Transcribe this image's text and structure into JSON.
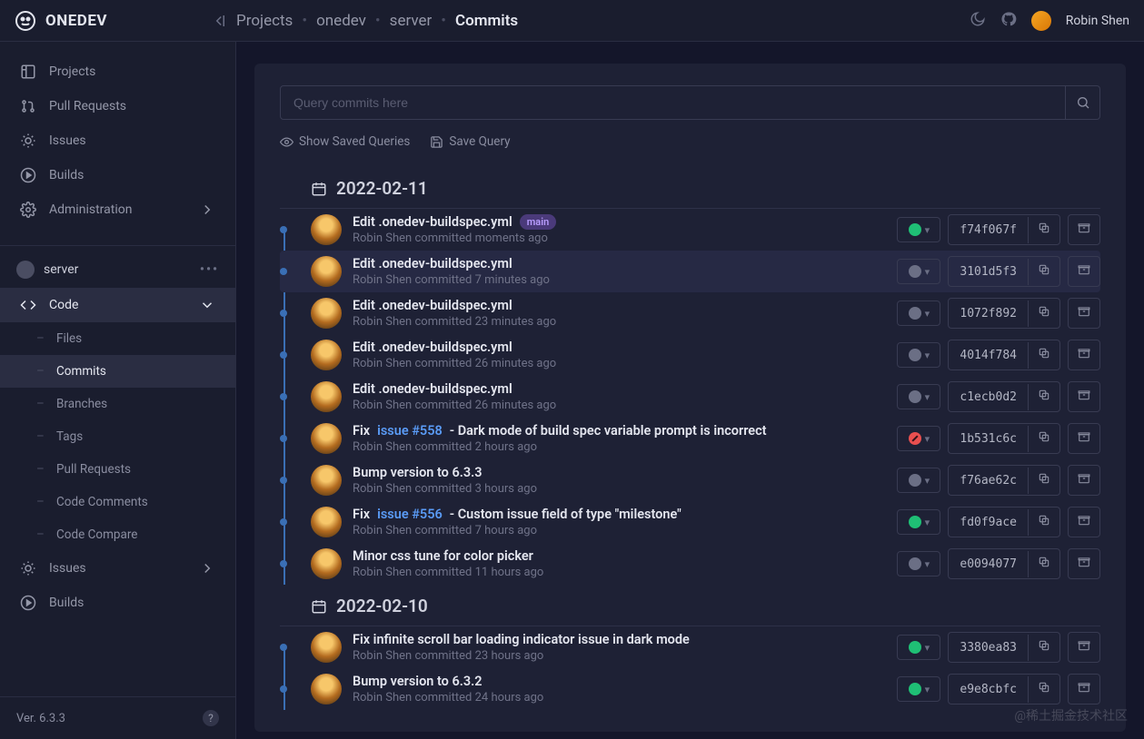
{
  "brand": {
    "name": "ONEDEV"
  },
  "breadcrumb": {
    "items": [
      "Projects",
      "onedev",
      "server",
      "Commits"
    ]
  },
  "user": {
    "name": "Robin Shen"
  },
  "sidebar": {
    "primary": [
      {
        "label": "Projects",
        "icon": "project-icon"
      },
      {
        "label": "Pull Requests",
        "icon": "pull-request-icon"
      },
      {
        "label": "Issues",
        "icon": "bug-icon"
      },
      {
        "label": "Builds",
        "icon": "play-icon"
      },
      {
        "label": "Administration",
        "icon": "gear-icon",
        "expandable": true
      }
    ],
    "project": {
      "name": "server"
    },
    "code": {
      "label": "Code",
      "children": [
        {
          "label": "Files"
        },
        {
          "label": "Commits",
          "active": true
        },
        {
          "label": "Branches"
        },
        {
          "label": "Tags"
        },
        {
          "label": "Pull Requests"
        },
        {
          "label": "Code Comments"
        },
        {
          "label": "Code Compare"
        }
      ]
    },
    "secondary": [
      {
        "label": "Issues",
        "icon": "bug-icon",
        "expandable": true
      },
      {
        "label": "Builds",
        "icon": "play-icon"
      }
    ],
    "version": "Ver. 6.3.3"
  },
  "search": {
    "placeholder": "Query commits here"
  },
  "query_actions": {
    "show": "Show Saved Queries",
    "save": "Save Query"
  },
  "groups": [
    {
      "date": "2022-02-11",
      "commits": [
        {
          "title": "Edit .onedev-buildspec.yml",
          "badge": "main",
          "author": "Robin Shen",
          "time": "moments ago",
          "status": "success",
          "hash": "f74f067f"
        },
        {
          "title": "Edit .onedev-buildspec.yml",
          "author": "Robin Shen",
          "time": "7 minutes ago",
          "status": "running",
          "hash": "3101d5f3",
          "hover": true
        },
        {
          "title": "Edit .onedev-buildspec.yml",
          "author": "Robin Shen",
          "time": "23 minutes ago",
          "status": "running",
          "hash": "1072f892"
        },
        {
          "title": "Edit .onedev-buildspec.yml",
          "author": "Robin Shen",
          "time": "26 minutes ago",
          "status": "running",
          "hash": "4014f784"
        },
        {
          "title": "Edit .onedev-buildspec.yml",
          "author": "Robin Shen",
          "time": "26 minutes ago",
          "status": "running",
          "hash": "c1ecb0d2"
        },
        {
          "title_prefix": "Fix ",
          "issue": "issue #558",
          "title_suffix": " - Dark mode of build spec variable prompt is incorrect",
          "author": "Robin Shen",
          "time": "2 hours ago",
          "status": "failed",
          "hash": "1b531c6c"
        },
        {
          "title": "Bump version to 6.3.3",
          "author": "Robin Shen",
          "time": "3 hours ago",
          "status": "running",
          "hash": "f76ae62c"
        },
        {
          "title_prefix": "Fix ",
          "issue": "issue #556",
          "title_suffix": " - Custom issue field of type \"milestone\"",
          "author": "Robin Shen",
          "time": "7 hours ago",
          "status": "success",
          "hash": "fd0f9ace"
        },
        {
          "title": "Minor css tune for color picker",
          "author": "Robin Shen",
          "time": "11 hours ago",
          "status": "running",
          "hash": "e0094077"
        }
      ]
    },
    {
      "date": "2022-02-10",
      "commits": [
        {
          "title": "Fix infinite scroll bar loading indicator issue in dark mode",
          "author": "Robin Shen",
          "time": "23 hours ago",
          "status": "success",
          "hash": "3380ea83"
        },
        {
          "title": "Bump version to 6.3.2",
          "author": "Robin Shen",
          "time": "24 hours ago",
          "status": "success",
          "hash": "e9e8cbfc"
        }
      ]
    }
  ],
  "meta_word": "committed",
  "watermark": "@稀土掘金技术社区"
}
